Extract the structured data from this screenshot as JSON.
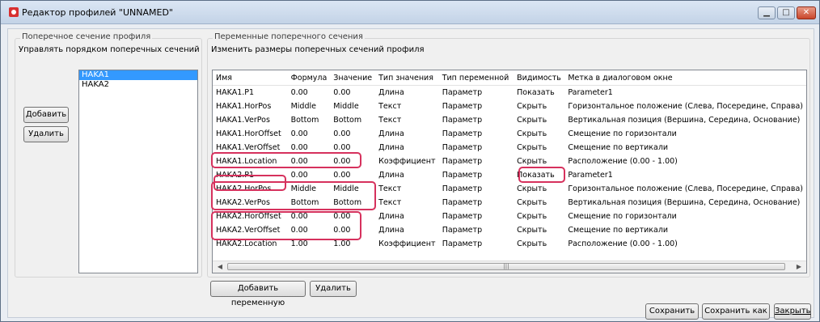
{
  "window": {
    "title": "Редактор профилей \"UNNAMED\""
  },
  "left": {
    "legend": "Поперечное сечение профиля",
    "subtitle": "Управлять порядком поперечных сечений",
    "add_label": "Добавить",
    "delete_label": "Удалить",
    "items": [
      "HAKA1",
      "HAKA2"
    ]
  },
  "right": {
    "legend": "Переменные поперечного сечения",
    "subtitle": "Изменить размеры поперечных сечений профиля",
    "columns": [
      "Имя",
      "Формула",
      "Значение",
      "Тип значения",
      "Тип переменной",
      "Видимость",
      "Метка в диалоговом окне"
    ],
    "rows": [
      [
        "HAKA1.P1",
        "0.00",
        "0.00",
        "Длина",
        "Параметр",
        "Показать",
        "Parameter1"
      ],
      [
        "HAKA1.HorPos",
        "Middle",
        "Middle",
        "Текст",
        "Параметр",
        "Скрыть",
        "Горизонтальное положение (Слева, Посередине, Справа)"
      ],
      [
        "HAKA1.VerPos",
        "Bottom",
        "Bottom",
        "Текст",
        "Параметр",
        "Скрыть",
        "Вертикальная позиция (Вершина, Середина, Основание)"
      ],
      [
        "HAKA1.HorOffset",
        "0.00",
        "0.00",
        "Длина",
        "Параметр",
        "Скрыть",
        "Смещение по горизонтали"
      ],
      [
        "HAKA1.VerOffset",
        "0.00",
        "0.00",
        "Длина",
        "Параметр",
        "Скрыть",
        "Смещение по вертикали"
      ],
      [
        "HAKA1.Location",
        "0.00",
        "0.00",
        "Коэффициент",
        "Параметр",
        "Скрыть",
        "Расположение (0.00 - 1.00)"
      ],
      [
        "HAKA2.P1",
        "0.00",
        "0.00",
        "Длина",
        "Параметр",
        "Показать",
        "Parameter1"
      ],
      [
        "HAKA2.HorPos",
        "Middle",
        "Middle",
        "Текст",
        "Параметр",
        "Скрыть",
        "Горизонтальное положение (Слева, Посередине, Справа)"
      ],
      [
        "HAKA2.VerPos",
        "Bottom",
        "Bottom",
        "Текст",
        "Параметр",
        "Скрыть",
        "Вертикальная позиция (Вершина, Середина, Основание)"
      ],
      [
        "HAKA2.HorOffset",
        "0.00",
        "0.00",
        "Длина",
        "Параметр",
        "Скрыть",
        "Смещение по горизонтали"
      ],
      [
        "HAKA2.VerOffset",
        "0.00",
        "0.00",
        "Длина",
        "Параметр",
        "Скрыть",
        "Смещение по вертикали"
      ],
      [
        "HAKA2.Location",
        "1.00",
        "1.00",
        "Коэффициент",
        "Параметр",
        "Скрыть",
        "Расположение (0.00 - 1.00)"
      ]
    ],
    "add_variable_label": "Добавить переменную",
    "delete_label": "Удалить"
  },
  "footer": {
    "save_label": "Сохранить",
    "save_as_label": "Сохранить как",
    "close_label": "Закрыть"
  },
  "colors": {
    "highlight": "#d6315d",
    "selection": "#3399ff"
  }
}
